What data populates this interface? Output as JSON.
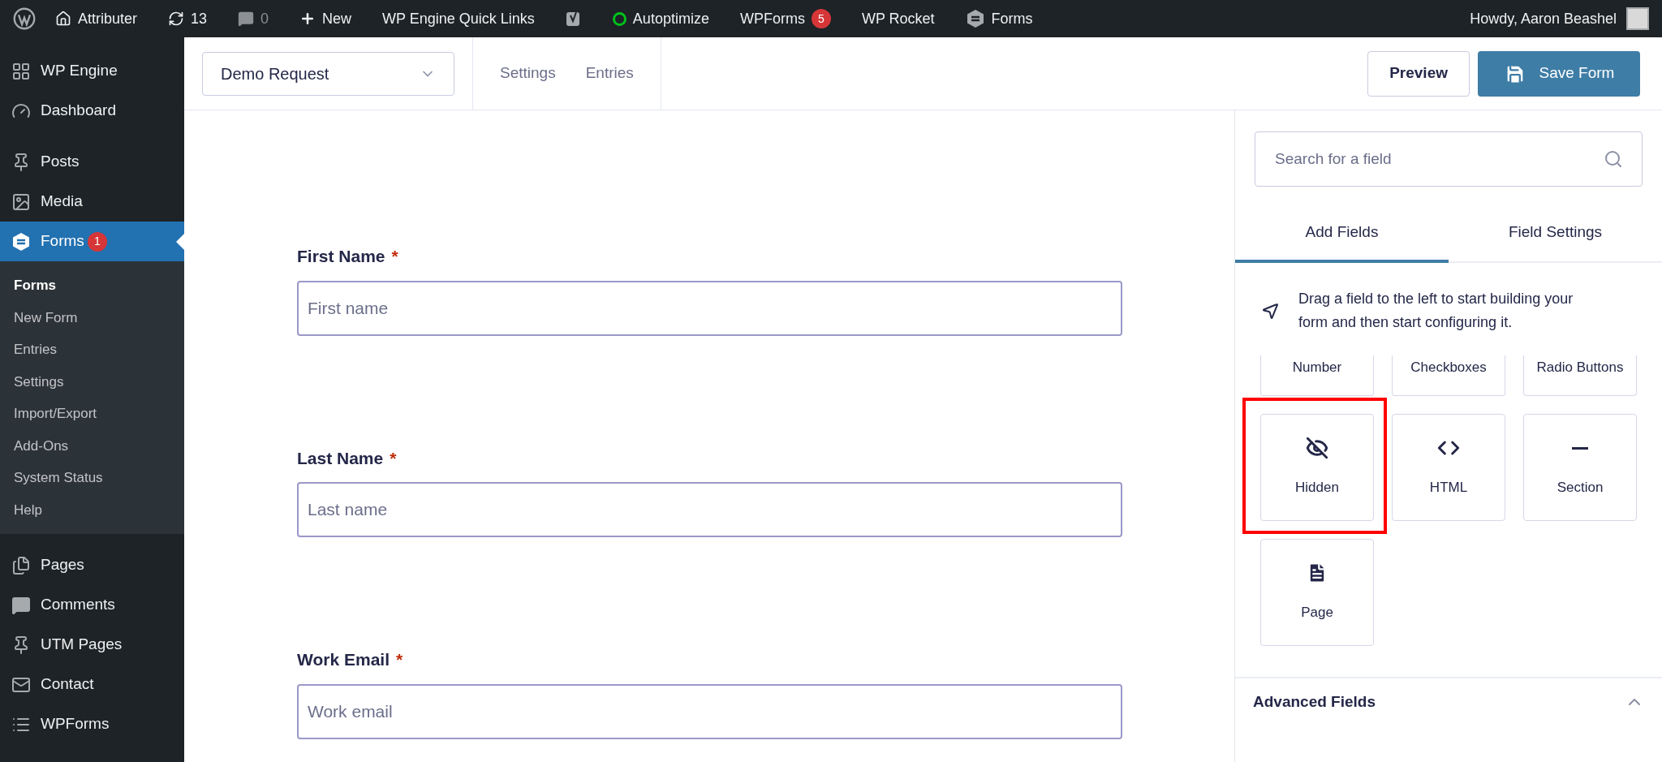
{
  "admin_bar": {
    "items": [
      {
        "kind": "home",
        "label": "Attributer"
      },
      {
        "kind": "updates",
        "label": "13"
      },
      {
        "kind": "comments",
        "label": "0",
        "muted": true
      },
      {
        "kind": "new",
        "label": "New"
      },
      {
        "kind": "text",
        "label": "WP Engine Quick Links"
      },
      {
        "kind": "yoast"
      },
      {
        "kind": "status",
        "label": "Autoptimize",
        "color": "#00c21a"
      },
      {
        "kind": "text",
        "label": "WPForms",
        "badge": "5"
      },
      {
        "kind": "text",
        "label": "WP Rocket"
      },
      {
        "kind": "forms",
        "label": "Forms"
      }
    ],
    "user": "Howdy, Aaron Beashel"
  },
  "sidebar": {
    "items": [
      {
        "kind": "grid",
        "label": "WP Engine",
        "selected": false
      },
      {
        "kind": "dashboard",
        "label": "Dashboard",
        "selected": false
      },
      {
        "kind": "pin",
        "label": "Posts",
        "selected": false
      },
      {
        "kind": "media",
        "label": "Media",
        "selected": false
      },
      {
        "kind": "forms",
        "label": "Forms",
        "selected": true,
        "badge": "1",
        "children": [
          {
            "label": "Forms",
            "selected": true
          },
          {
            "label": "New Form",
            "selected": false
          },
          {
            "label": "Entries",
            "selected": false
          },
          {
            "label": "Settings",
            "selected": false
          },
          {
            "label": "Import/Export",
            "selected": false
          },
          {
            "label": "Add-Ons",
            "selected": false
          },
          {
            "label": "System Status",
            "selected": false
          },
          {
            "label": "Help",
            "selected": false
          }
        ]
      },
      {
        "kind": "pages",
        "label": "Pages",
        "selected": false
      },
      {
        "kind": "comment",
        "label": "Comments",
        "selected": false
      },
      {
        "kind": "pin",
        "label": "UTM Pages",
        "selected": false
      },
      {
        "kind": "mail",
        "label": "Contact",
        "selected": false
      },
      {
        "kind": "list",
        "label": "WPForms",
        "selected": false
      }
    ]
  },
  "header": {
    "form_selector": "Demo Request",
    "nav": [
      "Settings",
      "Entries"
    ],
    "preview_button": "Preview",
    "save_button": "Save Form"
  },
  "form": {
    "fields": [
      {
        "label": "First Name",
        "required_mark": "*",
        "placeholder": "First name"
      },
      {
        "label": "Last Name",
        "required_mark": "*",
        "placeholder": "Last name"
      },
      {
        "label": "Work Email",
        "required_mark": "*",
        "placeholder": "Work email"
      }
    ]
  },
  "panel": {
    "search": {
      "placeholder": "Search for a field"
    },
    "tabs": [
      {
        "label": "Add Fields",
        "selected": true
      },
      {
        "label": "Field Settings",
        "selected": false
      }
    ],
    "hint": "Drag a field to the left to start building your form and then start configuring it.",
    "tiles": [
      {
        "kind": "none",
        "label": "Number",
        "clipped": true,
        "highlighted": false
      },
      {
        "kind": "none",
        "label": "Checkboxes",
        "clipped": true,
        "highlighted": false
      },
      {
        "kind": "none",
        "label": "Radio Buttons",
        "clipped": true,
        "highlighted": false
      },
      {
        "kind": "hidden",
        "label": "Hidden",
        "clipped": false,
        "highlighted": true
      },
      {
        "kind": "code",
        "label": "HTML",
        "clipped": false,
        "highlighted": false
      },
      {
        "kind": "section",
        "label": "Section",
        "clipped": false,
        "highlighted": false
      },
      {
        "kind": "page",
        "label": "Page",
        "clipped": false,
        "highlighted": false
      }
    ],
    "advanced": {
      "label": "Advanced Fields",
      "expanded": true
    }
  }
}
